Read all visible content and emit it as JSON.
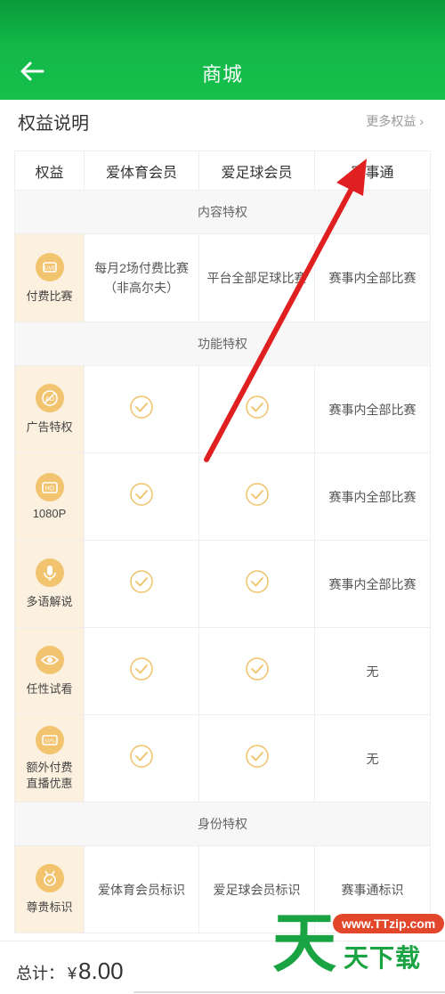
{
  "header": {
    "title": "商城"
  },
  "benefits": {
    "section_title": "权益说明",
    "more_link": "更多权益",
    "more_chevron": "›"
  },
  "table": {
    "columns": [
      "权益",
      "爱体育会员",
      "爱足球会员",
      "赛事通"
    ],
    "groups": [
      {
        "name": "内容特权"
      },
      {
        "name": "功能特权"
      },
      {
        "name": "身份特权"
      }
    ],
    "rows": {
      "paid_match": {
        "label": "付费比赛",
        "icon": "live-icon",
        "c1": "每月2场付费比赛\n（非高尔夫）",
        "c2": "平台全部足球比赛",
        "c3": "赛事内全部比赛"
      },
      "ad_privilege": {
        "label": "广告特权",
        "icon": "no-ad-icon",
        "c3": "赛事内全部比赛"
      },
      "p1080": {
        "label": "1080P",
        "icon": "hd-icon",
        "c3": "赛事内全部比赛"
      },
      "multi_commentary": {
        "label": "多语解说",
        "icon": "microphone-icon",
        "c3": "赛事内全部比赛"
      },
      "free_preview": {
        "label": "任性试看",
        "icon": "eye-icon",
        "c3": "无"
      },
      "extra_paid": {
        "label": "额外付费\n直播优惠",
        "icon": "coupon-icon",
        "c3": "无"
      },
      "badge": {
        "label": "尊贵标识",
        "icon": "medal-icon",
        "c1": "爱体育会员标识",
        "c2": "爱足球会员标识",
        "c3": "赛事通标识"
      }
    }
  },
  "footer": {
    "total_label": "总计：",
    "currency": "¥",
    "amount": "8.00"
  },
  "watermark": {
    "tian": "天",
    "url": "www.TTzip.com",
    "brand": "天下载"
  },
  "colors": {
    "header_green": "#16c04c",
    "row_label_bg": "#fcf0df",
    "icon_gold": "#f3c46f",
    "annotation_arrow": "#e02020"
  }
}
